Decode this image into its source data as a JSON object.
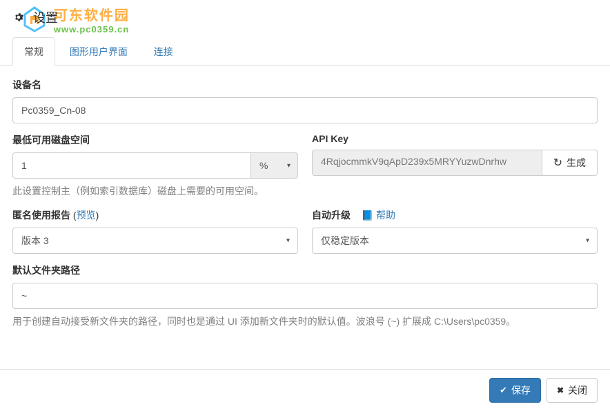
{
  "header": {
    "title": "设置"
  },
  "watermark": {
    "cn_text": "可东软件园",
    "url_text": "www.pc0359.cn"
  },
  "tabs": [
    {
      "label": "常规",
      "active": true
    },
    {
      "label": "图形用户界面",
      "active": false
    },
    {
      "label": "连接",
      "active": false
    }
  ],
  "device_name": {
    "label": "设备名",
    "value": "Pc0359_Cn-08"
  },
  "disk_space": {
    "label": "最低可用磁盘空间",
    "value": "1",
    "unit": "%",
    "help": "此设置控制主（例如索引数据库）磁盘上需要的可用空间。"
  },
  "api_key": {
    "label": "API Key",
    "value": "4RqjocmmkV9qApD239x5MRYYuzwDnrhw",
    "button": "生成"
  },
  "anon_report": {
    "label": "匿名使用报告",
    "preview_open": "(",
    "preview": "预览",
    "preview_close": ")",
    "value": "版本 3"
  },
  "auto_upgrade": {
    "label": "自动升级",
    "help_link": "帮助",
    "value": "仅稳定版本"
  },
  "default_path": {
    "label": "默认文件夹路径",
    "value": "~",
    "help": "用于创建自动接受新文件夹的路径，同时也是通过 UI 添加新文件夹时的默认值。波浪号 (~) 扩展成 C:\\Users\\pc0359。"
  },
  "footer": {
    "save": "保存",
    "close": "关闭"
  }
}
